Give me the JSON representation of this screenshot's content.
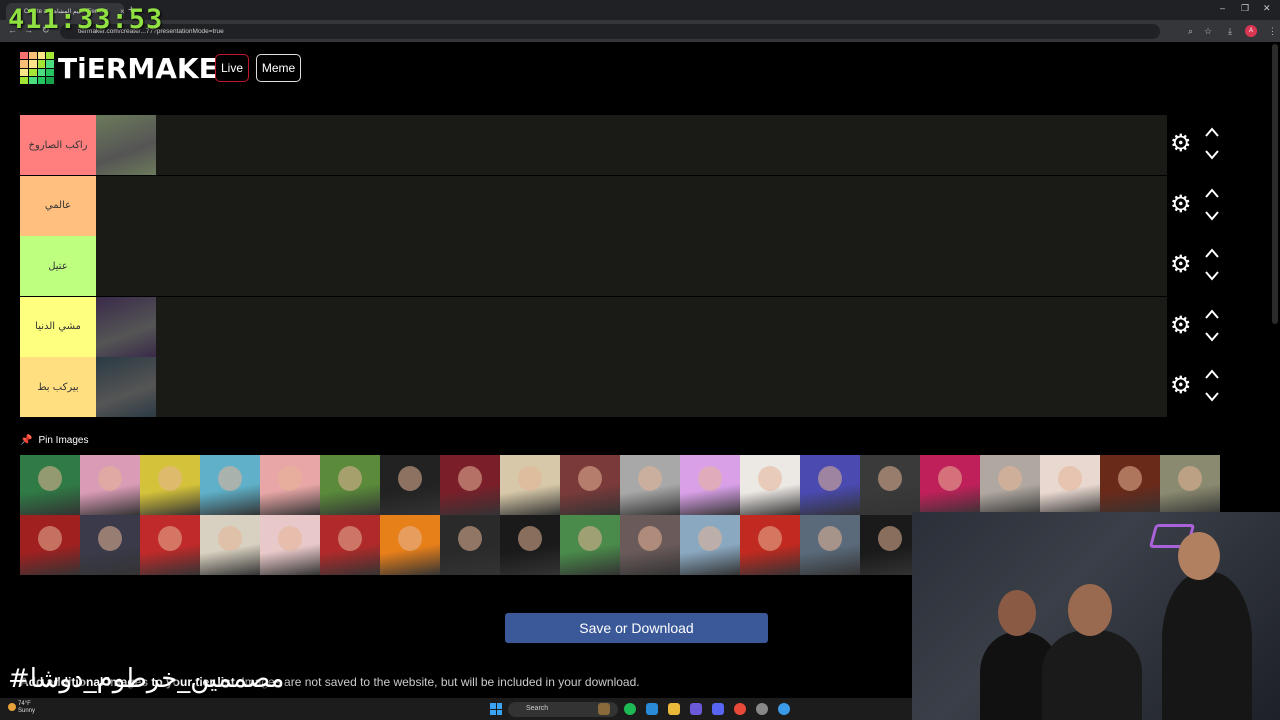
{
  "browser": {
    "tab_title": "Create a تقييم المشاهير Tier List",
    "url": "tiermaker.com/create/...77?presentationMode=true",
    "new_tab": "+",
    "tab_close": "×",
    "minimize": "–",
    "restore": "❐",
    "close": "✕",
    "profile_initial": "A"
  },
  "overlay": {
    "timer": "411:33:53",
    "watermark": "#مصممين_خرطوم_دوشا"
  },
  "site": {
    "logo_text": "TiERMAKER",
    "live_label": "Live",
    "meme_label": "Meme",
    "logo_colors": [
      "#f87171",
      "#fbbf77",
      "#fde68a",
      "#a3e635",
      "#fbbf77",
      "#fde68a",
      "#a3e635",
      "#4ade80",
      "#fde68a",
      "#a3e635",
      "#4ade80",
      "#22c55e",
      "#a3e635",
      "#4ade80",
      "#22c55e",
      "#16a34a"
    ]
  },
  "tiers": [
    {
      "label": "راكب الصاروخ",
      "color": "#ff7f7f",
      "items": 1,
      "item_color": "#6b7a5a"
    },
    {
      "label": "عالمي",
      "color": "#ffbf7f",
      "items": 0
    },
    {
      "label": "عتيل",
      "color": "#bfff7f",
      "items": 0
    },
    {
      "label": "مشي الدنيا",
      "color": "#ffff7f",
      "items": 1,
      "item_color": "#3a2a4a"
    },
    {
      "label": "بيركب بط",
      "color": "#ffdf7f",
      "items": 1,
      "item_color": "#2a3a44"
    }
  ],
  "tier_controls": {
    "gear_icon": "⚙"
  },
  "pin": {
    "label": "Pin Images",
    "icon": "📌"
  },
  "pool_colors": [
    "#2f7a45",
    "#d99bb5",
    "#d4c23a",
    "#5fb0c8",
    "#e8a6a6",
    "#5a8a3a",
    "#222222",
    "#7a1f2a",
    "#d6c8a8",
    "#7a3a3a",
    "#a8a8a8",
    "#d9a0e8",
    "#ece8e4",
    "#4a4ab0",
    "#3a3a3a",
    "#c0205a",
    "#b0a8a0",
    "#e8d8d0",
    "#6a2a1a",
    "#8a8a70",
    "#a02020",
    "#3a3a4a",
    "#c02a2a",
    "#d8d0c0",
    "#e8c8c8",
    "#b02a2a",
    "#e8801a",
    "#2a2a2a",
    "#1a1a1a",
    "#4a8a4a",
    "#6a5a5a",
    "#8aa8c0",
    "#c02a20",
    "#5a6a7a",
    "#1a1a1a",
    "#3a3a3a",
    "#aaaaaa",
    "#aaaaaa",
    "#aaaaaa",
    "#aaaaaa"
  ],
  "actions": {
    "save_label": "Save or Download"
  },
  "note": {
    "bold": "Add additional images to your tier list.",
    "rest": " Images are not saved to the website, but will be included in your download."
  },
  "taskbar": {
    "weather_temp": "74°F",
    "weather_desc": "Sunny",
    "search_placeholder": "Search"
  }
}
